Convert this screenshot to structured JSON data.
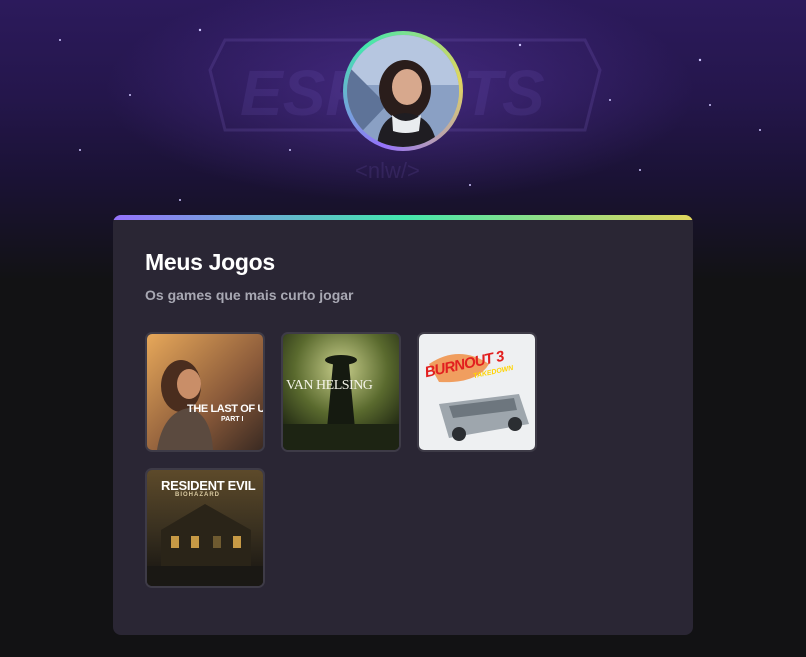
{
  "profile": {
    "avatar_alt": "Foto de perfil"
  },
  "card": {
    "title": "Meus Jogos",
    "subtitle": "Os games que mais curto jogar"
  },
  "games": [
    {
      "label": "THE LAST OF US",
      "sub": "PART I"
    },
    {
      "label": "VAN HELSING",
      "sub": ""
    },
    {
      "label": "BURNOUT 3",
      "sub": "TAKEDOWN"
    },
    {
      "label": "RESIDENT EVIL",
      "sub": "BIOHAZARD"
    }
  ],
  "colors": {
    "background": "#121214",
    "card": "#2a2634",
    "accent_purple": "#9572fc",
    "accent_green": "#43e7ad",
    "accent_yellow": "#e1d55d",
    "subtitle": "#a8a8b3"
  }
}
